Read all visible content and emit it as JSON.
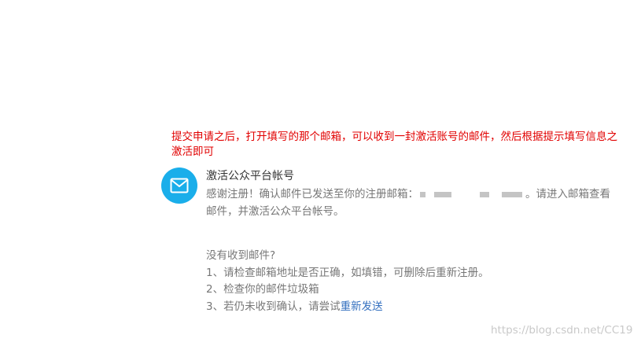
{
  "annotation": {
    "line1": "提交申请之后，打开填写的那个邮箱，可以收到一封激活账号的邮件，然后根据提示填写信息之",
    "line2": "激活即可",
    "color": "#e10000"
  },
  "card": {
    "icon": "mail-icon",
    "icon_bg": "#1aaeea",
    "title": "激活公众平台帐号",
    "body_prefix": "感谢注册！确认邮件已发送至你的注册邮箱：",
    "body_suffix": "。请进入邮箱查看",
    "body_line2": "邮件，并激活公众平台帐号。"
  },
  "help": {
    "title": "没有收到邮件?",
    "item1": "1、请检查邮箱地址是否正确，如填错，可删除后重新注册。",
    "item2": "2、检查你的邮件垃圾箱",
    "item3_prefix": "3、若仍未收到确认，请尝试",
    "item3_link": "重新发送",
    "link_color": "#3470bf"
  },
  "watermark": "https://blog.csdn.net/CC19"
}
